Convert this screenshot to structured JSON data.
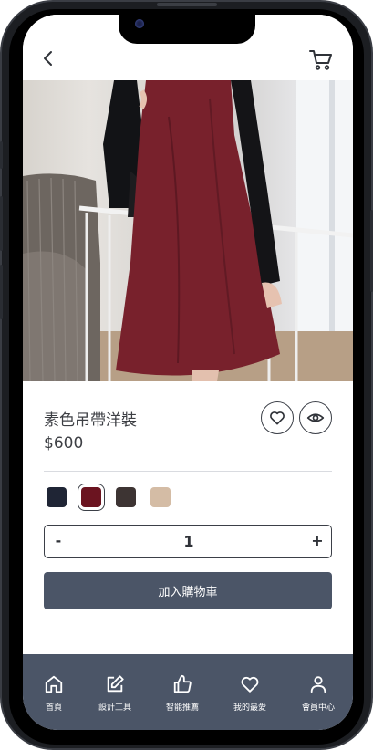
{
  "product": {
    "name": "素色吊帶洋裝",
    "price": "$600"
  },
  "colors": {
    "accent": "#4b5567",
    "options": [
      "#1f2535",
      "#6b1420",
      "#3d3433",
      "#d4bca5"
    ],
    "selected_index": 1
  },
  "quantity": {
    "minus_label": "-",
    "value": "1",
    "plus_label": "+"
  },
  "actions": {
    "add_to_cart_label": "加入購物車"
  },
  "icons": {
    "back": "chevron-left-icon",
    "cart": "cart-icon",
    "favorite": "heart-icon",
    "view": "eye-icon"
  },
  "nav": {
    "items": [
      {
        "label": "首頁",
        "icon": "home-icon"
      },
      {
        "label": "設計工具",
        "icon": "edit-icon"
      },
      {
        "label": "智能推薦",
        "icon": "thumbs-up-icon"
      },
      {
        "label": "我的最愛",
        "icon": "heart-icon"
      },
      {
        "label": "會員中心",
        "icon": "user-icon"
      }
    ]
  }
}
